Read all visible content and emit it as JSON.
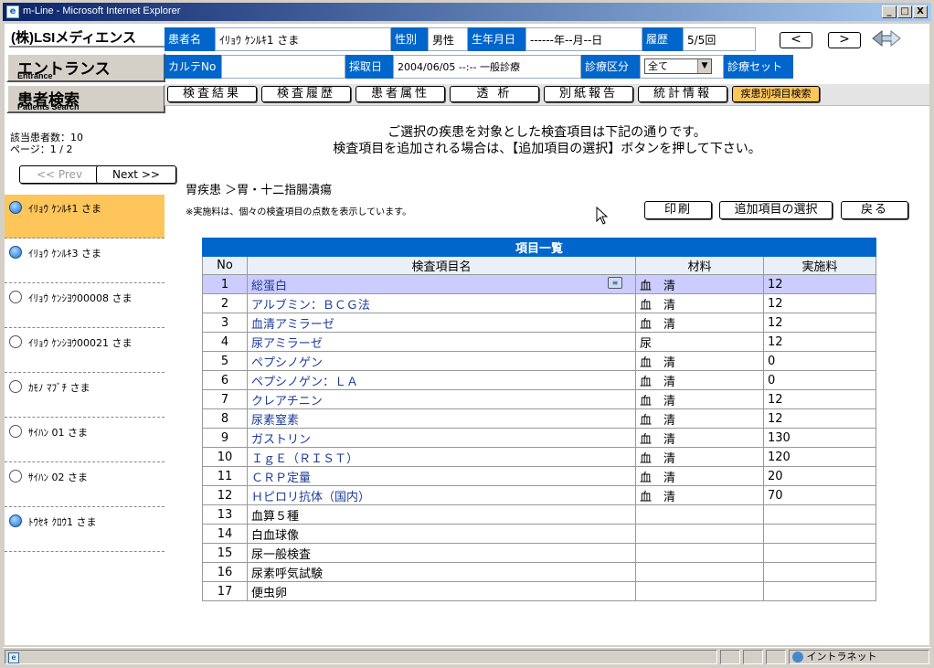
{
  "window": {
    "title": "m-Line - Microsoft Internet Explorer",
    "min": "_",
    "max": "□",
    "close": "X"
  },
  "left": {
    "logo": "(株)LSIメディエンス",
    "entrance": {
      "label": "エントランス",
      "sub": "Entrance"
    },
    "patients_search": {
      "label": "患者検索",
      "sub": "Patients Search"
    },
    "count_label": "該当患者数：10",
    "page_label": "ページ：1 / 2",
    "prev": "<< Prev",
    "next": "Next >>",
    "patients": [
      {
        "name": "ｲﾘｮｳ ｹﾝﾙｷ1 さま",
        "icon": "blue"
      },
      {
        "name": "ｲﾘｮｳ ｹﾝﾙｷ3 さま",
        "icon": "blue"
      },
      {
        "name": "ｲﾘｮｳ ｹﾝｼﾖｳ00008 さま",
        "icon": "empty"
      },
      {
        "name": "ｲﾘｮｳ ｹﾝｼﾖｳ00021 さま",
        "icon": "empty"
      },
      {
        "name": "ｶﾓﾉ ﾏﾌﾞﾁ さま",
        "icon": "empty"
      },
      {
        "name": "ｻｲﾊﾝ 01 さま",
        "icon": "empty"
      },
      {
        "name": "ｻｲﾊﾝ 02 さま",
        "icon": "empty"
      },
      {
        "name": "ﾄｳｾｷ ｸﾛｳ1 さま",
        "icon": "blue"
      }
    ]
  },
  "header": {
    "patient_label": "患者名",
    "patient_value": "ｲﾘｮｳ ｹﾝﾙｷ1 さま",
    "sex_label": "性別",
    "sex_value": "男性",
    "dob_label": "生年月日",
    "dob_value": "------年--月--日",
    "history_label": "履歴",
    "history_value": "5/5回",
    "prev_arrow": "<",
    "next_arrow": ">",
    "karte_label": "カルテNo",
    "karte_value": "",
    "sampling_label": "採取日",
    "sampling_value": "2004/06/05 --:-- 一般診療",
    "dept_label": "診療区分",
    "dept_value": "全て",
    "set_label": "診療セット"
  },
  "tabs": [
    "検査結果",
    "検査履歴",
    "患者属性",
    "透 析",
    "別紙報告",
    "統計情報",
    "疾患別項目検索"
  ],
  "message": {
    "line1": "ご選択の疾患を対象とした検査項目は下記の通りです。",
    "line2": "検査項目を追加される場合は、【追加項目の選択】ボタンを押して下さい。"
  },
  "breadcrumb": "胃疾患 ＞胃・十二指腸潰瘍",
  "note": "※実施料は、個々の検査項目の点数を表示しています。",
  "buttons": {
    "print": "印刷",
    "add": "追加項目の選択",
    "back": "戻る"
  },
  "table": {
    "caption": "項目一覧",
    "headers": [
      "No",
      "検査項目名",
      "材料",
      "実施料"
    ],
    "rows": [
      {
        "no": "1",
        "name": "総蛋白",
        "material": "血　清",
        "fee": "12"
      },
      {
        "no": "2",
        "name": "アルブミン：ＢＣＧ法",
        "material": "血　清",
        "fee": "12"
      },
      {
        "no": "3",
        "name": "血清アミラーゼ",
        "material": "血　清",
        "fee": "12"
      },
      {
        "no": "4",
        "name": "尿アミラーゼ",
        "material": "尿",
        "fee": "12"
      },
      {
        "no": "5",
        "name": "ペプシノゲン",
        "material": "血　清",
        "fee": "0"
      },
      {
        "no": "6",
        "name": "ペプシノゲン：ＬＡ",
        "material": "血　清",
        "fee": "0"
      },
      {
        "no": "7",
        "name": "クレアチニン",
        "material": "血　清",
        "fee": "12"
      },
      {
        "no": "8",
        "name": "尿素窒素",
        "material": "血　清",
        "fee": "12"
      },
      {
        "no": "9",
        "name": "ガストリン",
        "material": "血　清",
        "fee": "130"
      },
      {
        "no": "10",
        "name": "ＩｇＥ（ＲＩＳＴ）",
        "material": "血　清",
        "fee": "120"
      },
      {
        "no": "11",
        "name": "ＣＲＰ定量",
        "material": "血　清",
        "fee": "20"
      },
      {
        "no": "12",
        "name": "Ｈピロリ抗体（国内）",
        "material": "血　清",
        "fee": "70"
      },
      {
        "no": "13",
        "name": "血算５種",
        "material": "",
        "fee": ""
      },
      {
        "no": "14",
        "name": "白血球像",
        "material": "",
        "fee": ""
      },
      {
        "no": "15",
        "name": "尿一般検査",
        "material": "",
        "fee": ""
      },
      {
        "no": "16",
        "name": "尿素呼気試験",
        "material": "",
        "fee": ""
      },
      {
        "no": "17",
        "name": "便虫卵",
        "material": "",
        "fee": ""
      }
    ]
  },
  "status": {
    "zone": "イントラネット"
  }
}
